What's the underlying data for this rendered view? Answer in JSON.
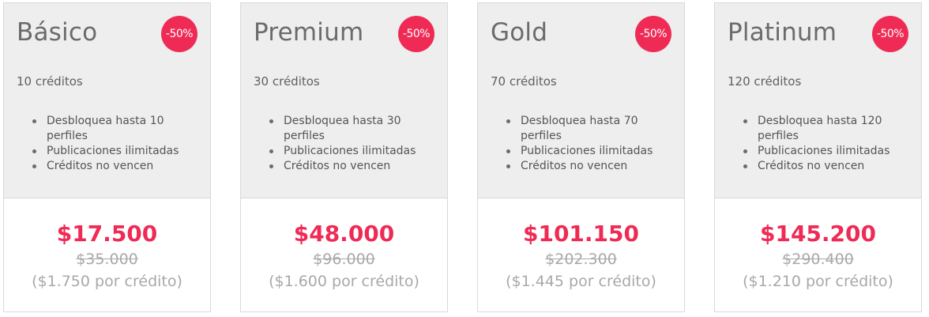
{
  "plans": [
    {
      "name": "Básico",
      "badge": "-50%",
      "credits": "10 créditos",
      "features": [
        "Desbloquea hasta 10 perfiles",
        "Publicaciones ilimitadas",
        "Créditos no vencen"
      ],
      "price": "$17.500",
      "old_price": "$35.000",
      "per_credit": "($1.750 por crédito)"
    },
    {
      "name": "Premium",
      "badge": "-50%",
      "credits": "30 créditos",
      "features": [
        "Desbloquea hasta 30 perfiles",
        "Publicaciones ilimitadas",
        "Créditos no vencen"
      ],
      "price": "$48.000",
      "old_price": "$96.000",
      "per_credit": "($1.600 por crédito)"
    },
    {
      "name": "Gold",
      "badge": "-50%",
      "credits": "70 créditos",
      "features": [
        "Desbloquea hasta 70 perfiles",
        "Publicaciones ilimitadas",
        "Créditos no vencen"
      ],
      "price": "$101.150",
      "old_price": "$202.300",
      "per_credit": "($1.445 por crédito)"
    },
    {
      "name": "Platinum",
      "badge": "-50%",
      "credits": "120 créditos",
      "features": [
        "Desbloquea hasta 120 perfiles",
        "Publicaciones ilimitadas",
        "Créditos no vencen"
      ],
      "price": "$145.200",
      "old_price": "$290.400",
      "per_credit": "($1.210 por crédito)"
    }
  ],
  "colors": {
    "accent": "#ef2b55",
    "card_top_bg": "#eeeeee",
    "muted_text": "#a8a8a8"
  }
}
